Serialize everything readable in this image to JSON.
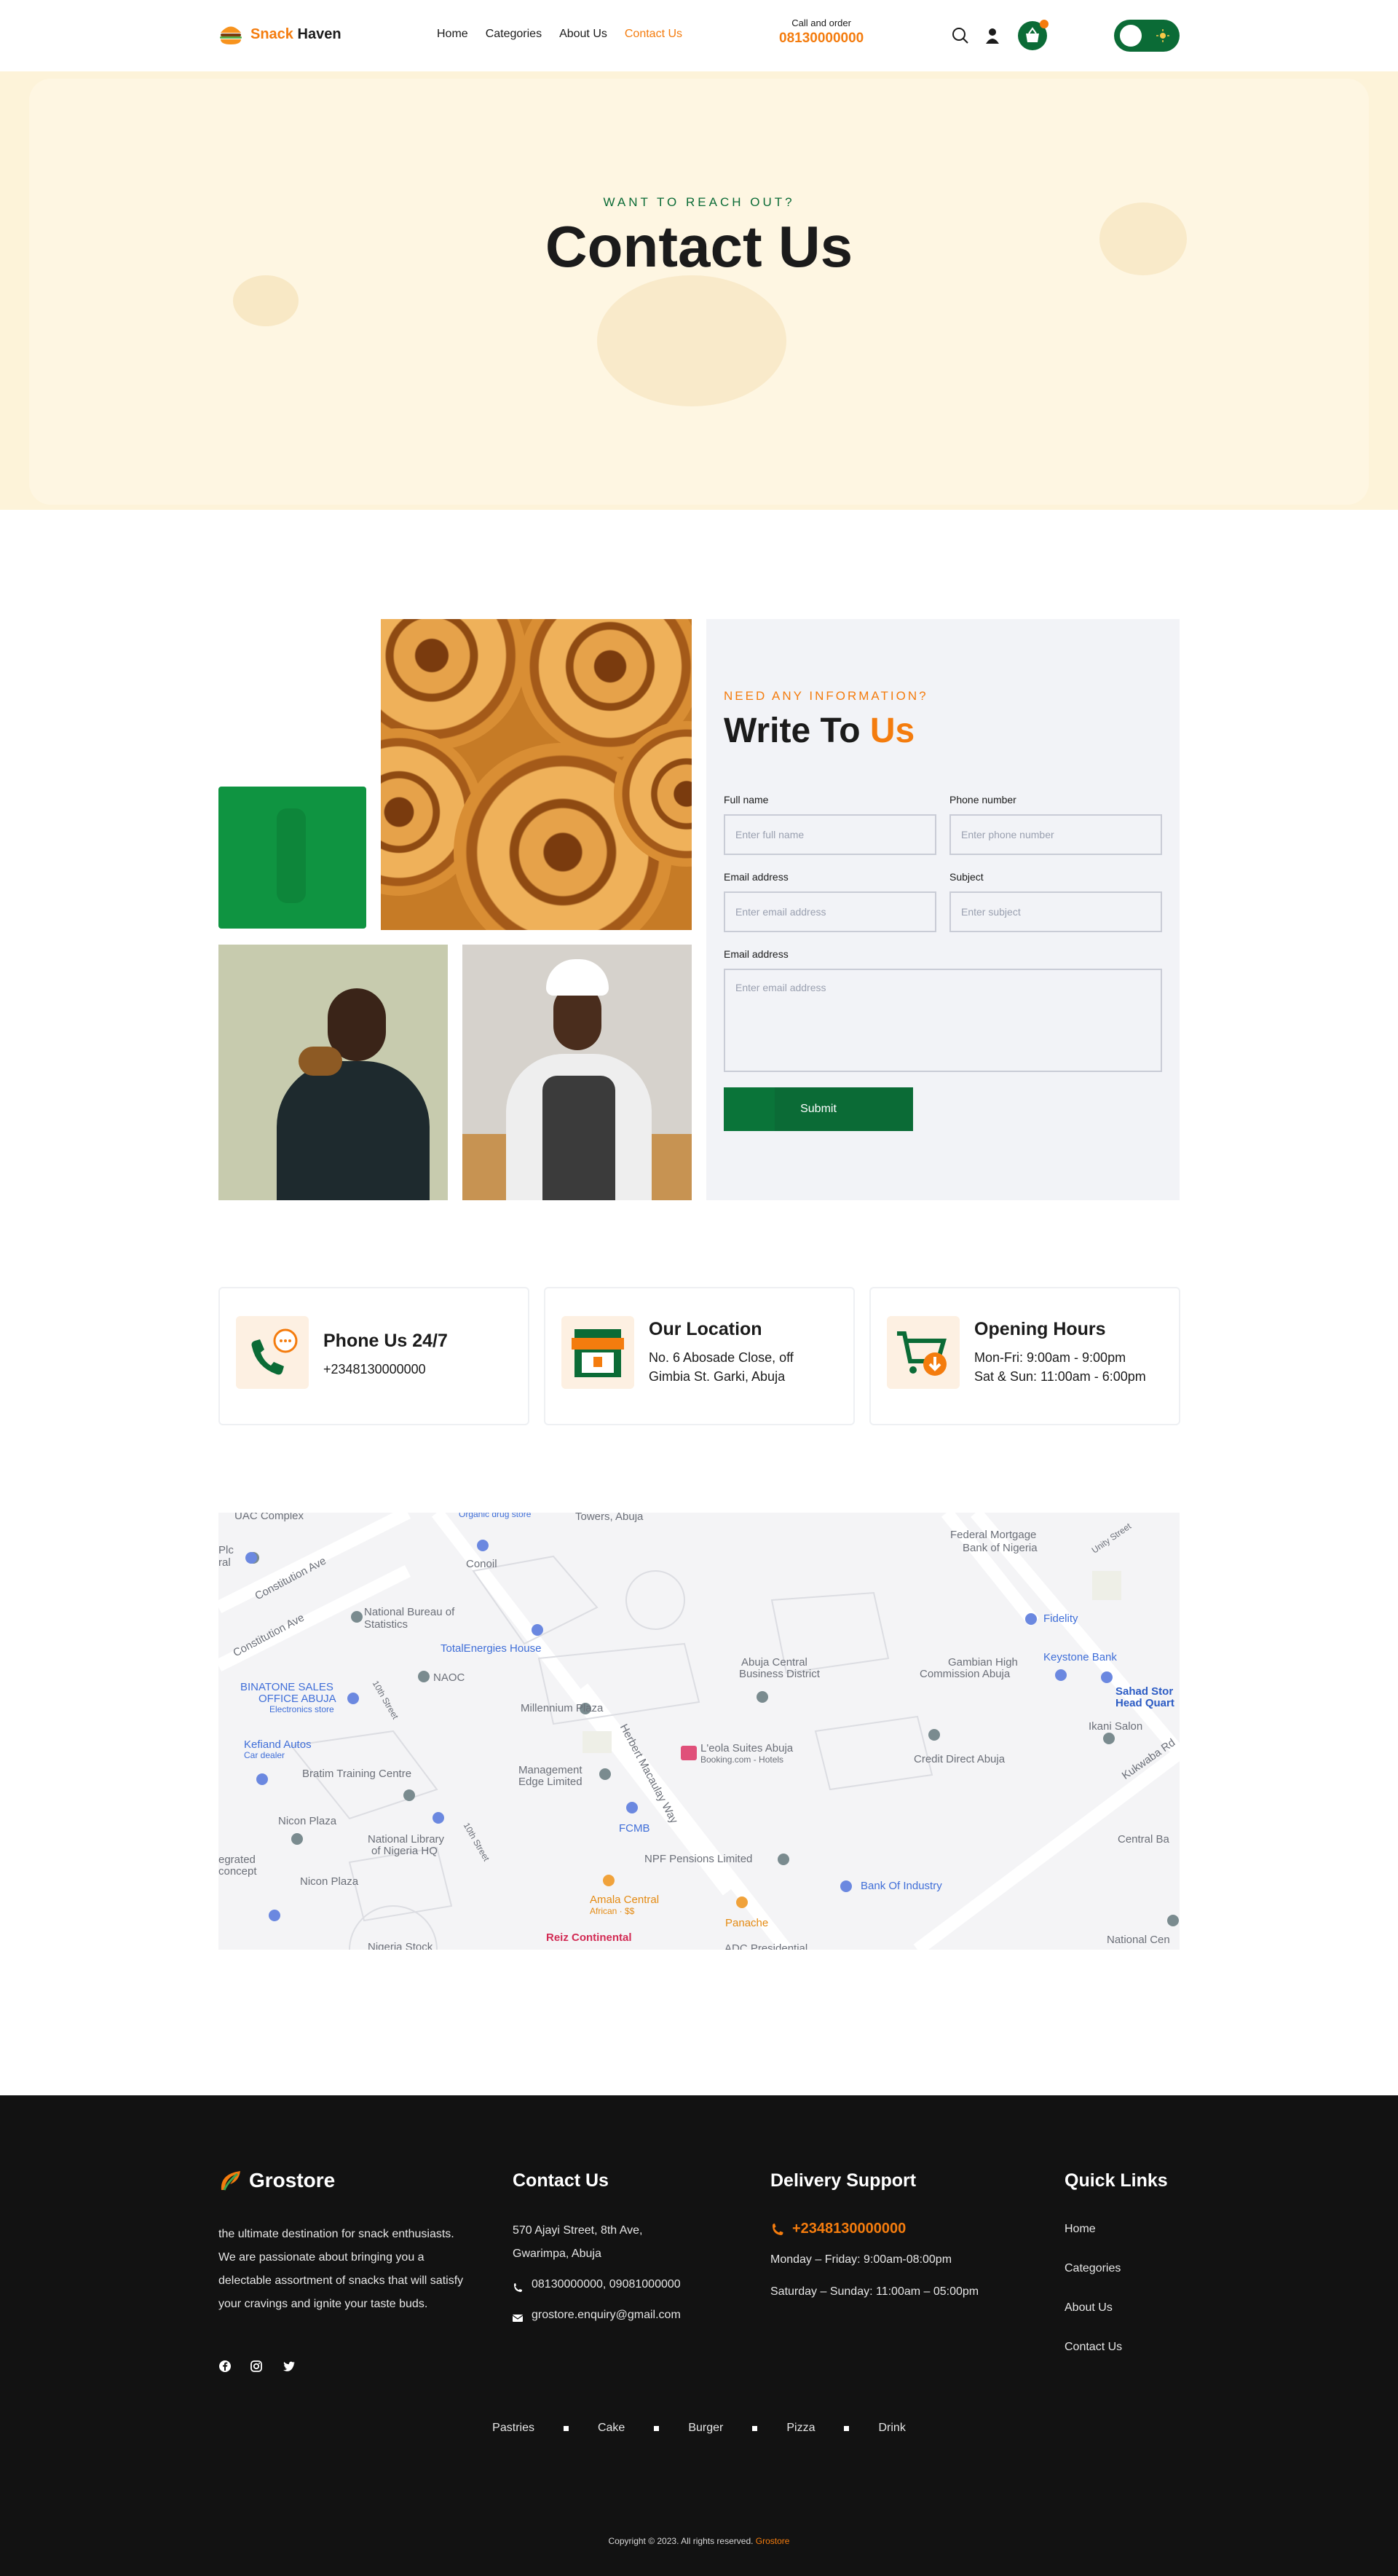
{
  "header": {
    "logo_part1": "Snack",
    "logo_part2": "Haven",
    "nav": [
      {
        "label": "Home",
        "active": false
      },
      {
        "label": "Categories",
        "active": false
      },
      {
        "label": "About Us",
        "active": false
      },
      {
        "label": "Contact Us",
        "active": true
      }
    ],
    "call_label": "Call and order",
    "call_number": "08130000000",
    "cart_badge_color": "#f47c0e",
    "accent_color": "#f47c0e",
    "brand_green": "#0b6b36"
  },
  "hero": {
    "eyebrow": "WANT TO REACH OUT?",
    "title": "Contact Us"
  },
  "form": {
    "eyebrow": "NEED ANY INFORMATION?",
    "title_part1": "Write To",
    "title_part2": "Us",
    "full_name_label": "Full name",
    "full_name_placeholder": "Enter full name",
    "phone_label": "Phone number",
    "phone_placeholder": "Enter phone number",
    "email_label": "Email address",
    "email_placeholder": "Enter email address",
    "subject_label": "Subject",
    "subject_placeholder": "Enter subject",
    "message_label": "Email address",
    "message_placeholder": "Enter email address",
    "submit_label": "Submit"
  },
  "info_cards": [
    {
      "title": "Phone Us 24/7",
      "line1": "+2348130000000",
      "line2": "",
      "icon": "phone-chat-icon"
    },
    {
      "title": "Our Location",
      "line1": "No. 6 Abosade Close, off",
      "line2": "Gimbia St. Garki, Abuja",
      "icon": "storefront-icon"
    },
    {
      "title": "Opening Hours",
      "line1": "Mon-Fri: 9:00am - 9:00pm",
      "line2": "Sat & Sun: 11:00am - 6:00pm",
      "icon": "cart-download-icon"
    }
  ],
  "map": {
    "labels": [
      "UAC Complex",
      "Organic drug store",
      "Towers, Abuja",
      "Federal Mortgage",
      "Bank of Nigeria",
      "Unity Street",
      "Constitution Ave",
      "Constitution Ave",
      "Conoil",
      "National Bureau of",
      "Statistics",
      "TotalEnergies House",
      "Fidelity",
      "Keystone Bank",
      "Gambian High",
      "Commission Abuja",
      "Abuja Central",
      "Business District",
      "BINATONE SALES",
      "OFFICE ABUJA",
      "Electronics store",
      "NAOC",
      "Millennium Plaza",
      "10th Street",
      "Sahad Stor",
      "Head Quart",
      "Ikani Salon",
      "Kukwaba Rd",
      "Kefiand Autos",
      "Car dealer",
      "Herbert Macaulay Way",
      "L'eola Suites Abuja",
      "Booking.com - Hotels",
      "Credit Direct Abuja",
      "Bratim Training Centre",
      "Management",
      "Edge Limited",
      "Nicon Plaza",
      "National Library",
      "of Nigeria HQ",
      "FCMB",
      "10th Street",
      "NPF Pensions Limited",
      "Central Ba",
      "egrated",
      "concept",
      "Nicon Plaza",
      "Bank Of Industry",
      "Amala Central",
      "African · $$",
      "Panache",
      "Reiz Continental",
      "Nigeria Stock",
      "ADC Presidential",
      "National Cen",
      "Plc",
      "ral"
    ]
  },
  "footer": {
    "logo_text": "Grostore",
    "about": "the ultimate destination for snack enthusiasts. We are passionate about bringing you a delectable assortment of snacks that will satisfy your cravings and ignite your taste buds.",
    "contact_title": "Contact Us",
    "address_line1": "570 Ajayi Street, 8th Ave,",
    "address_line2": "Gwarimpa, Abuja",
    "phones": "08130000000,  09081000000",
    "email": "grostore.enquiry@gmail.com",
    "support_title": "Delivery Support",
    "support_phone": "+2348130000000",
    "weekday_hours": "Monday – Friday: 9:00am-08:00pm",
    "weekend_hours": "Saturday – Sunday: 11:00am – 05:00pm",
    "links_title": "Quick Links",
    "links": [
      "Home",
      "Categories",
      "About Us",
      "Contact Us"
    ],
    "categories": [
      "Pastries",
      "Cake",
      "Burger",
      "Pizza",
      "Drink"
    ],
    "copyright": "Copyright © 2023. All rights reserved.",
    "copyright_brand": "Grostore"
  }
}
